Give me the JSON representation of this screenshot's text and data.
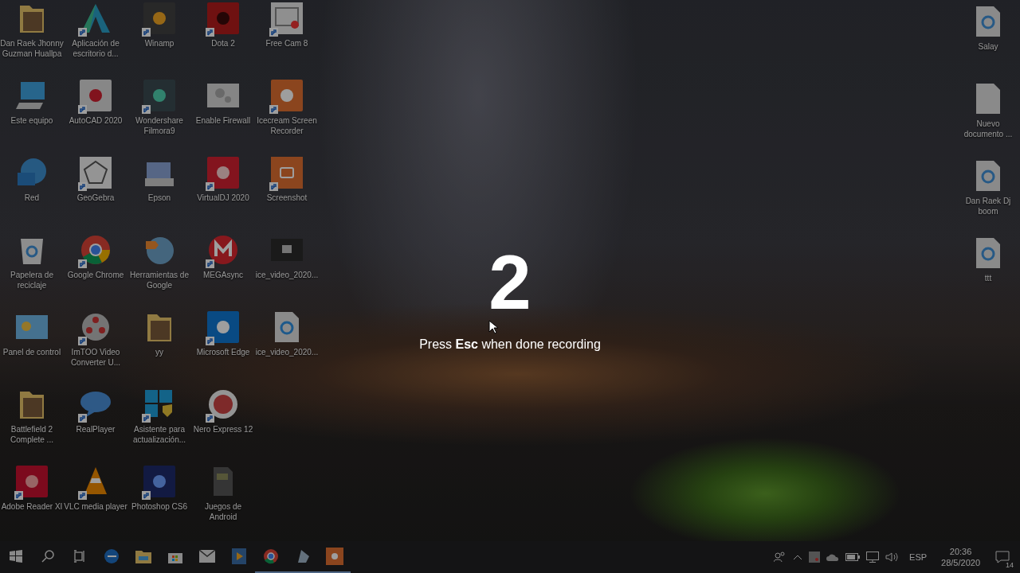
{
  "desktop": {
    "columns": [
      {
        "icons": [
          {
            "label": "Dan Raek Jhonny Guzman Huallpa",
            "shortcut": false
          },
          {
            "label": "Este equipo",
            "shortcut": false
          },
          {
            "label": "Red",
            "shortcut": false
          },
          {
            "label": "Papelera de reciclaje",
            "shortcut": false
          },
          {
            "label": "Panel de control",
            "shortcut": false
          },
          {
            "label": "Battlefield 2 Complete ...",
            "shortcut": false
          },
          {
            "label": "Adobe Reader XI",
            "shortcut": true
          }
        ]
      },
      {
        "icons": [
          {
            "label": "Aplicación de escritorio d...",
            "shortcut": true
          },
          {
            "label": "AutoCAD 2020",
            "shortcut": true
          },
          {
            "label": "GeoGebra",
            "shortcut": true
          },
          {
            "label": "Google Chrome",
            "shortcut": true
          },
          {
            "label": "ImTOO Video Converter U...",
            "shortcut": true
          },
          {
            "label": "RealPlayer",
            "shortcut": true
          },
          {
            "label": "VLC media player",
            "shortcut": true
          }
        ]
      },
      {
        "icons": [
          {
            "label": "Winamp",
            "shortcut": true
          },
          {
            "label": "Wondershare Filmora9",
            "shortcut": true
          },
          {
            "label": "Epson",
            "shortcut": false
          },
          {
            "label": "Herramientas de Google",
            "shortcut": false
          },
          {
            "label": "yy",
            "shortcut": false
          },
          {
            "label": "Asistente para actualización...",
            "shortcut": true
          },
          {
            "label": "Photoshop CS6",
            "shortcut": true
          }
        ]
      },
      {
        "icons": [
          {
            "label": "Dota 2",
            "shortcut": true
          },
          {
            "label": "Enable Firewall",
            "shortcut": false
          },
          {
            "label": "VirtualDJ 2020",
            "shortcut": true
          },
          {
            "label": "MEGAsync",
            "shortcut": true
          },
          {
            "label": "Microsoft Edge",
            "shortcut": true
          },
          {
            "label": "Nero Express 12",
            "shortcut": true
          },
          {
            "label": "Juegos de Android",
            "shortcut": false
          }
        ]
      },
      {
        "icons": [
          {
            "label": "Free Cam 8",
            "shortcut": true
          },
          {
            "label": "Icecream Screen Recorder",
            "shortcut": true
          },
          {
            "label": "Screenshot",
            "shortcut": true
          },
          {
            "label": "ice_video_2020...",
            "shortcut": false
          },
          {
            "label": "ice_video_2020...",
            "shortcut": false
          }
        ]
      }
    ],
    "right_column": {
      "icons": [
        {
          "label": "Salay",
          "shortcut": false
        },
        {
          "label": "Nuevo documento ...",
          "shortcut": false
        },
        {
          "label": "Dan Raek Dj boom",
          "shortcut": false
        },
        {
          "label": "ttt",
          "shortcut": false
        }
      ]
    }
  },
  "countdown": {
    "number": "2",
    "hint": "Press **Esc** when done recording"
  },
  "taskbar": {
    "apps": [
      {
        "running": false
      },
      {
        "running": false
      },
      {
        "running": false
      },
      {
        "running": false
      },
      {
        "running": false
      },
      {
        "running": true
      },
      {
        "running": true
      },
      {
        "running": true
      }
    ]
  },
  "tray": {
    "language": "ESP",
    "time": "20:36",
    "date": "28/5/2020",
    "notifications": "14"
  }
}
